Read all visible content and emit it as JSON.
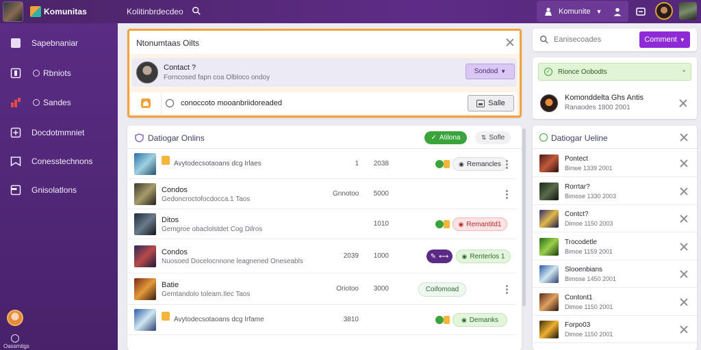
{
  "topbar": {
    "app_name": "Komunitas",
    "breadcrumb": "Kolitinbrdecdeo",
    "community_label": "Komunite"
  },
  "sidebar": {
    "items": [
      {
        "label": "Sapebnaniar",
        "icon": "page-icon"
      },
      {
        "label": "Rbniots",
        "icon": "bookmark-icon"
      },
      {
        "label": "Sandes",
        "icon": "chart-icon"
      },
      {
        "label": "Docdotmmniet",
        "icon": "add-document-icon"
      },
      {
        "label": "Conesstechnons",
        "icon": "inbox-icon"
      },
      {
        "label": "Gnisolatlons",
        "icon": "list-icon"
      }
    ],
    "bottom_label": "Oassmtigs"
  },
  "main_top": {
    "title": "Ntonumtaas Oilts",
    "notice": {
      "name": "Contact ?",
      "subtitle": "Forncosed fapn coa Olbloco ondoy",
      "button": "Sondod"
    },
    "input": {
      "value": "conoccoto mooanbriidoreaded",
      "save_label": "Salle"
    }
  },
  "main_list": {
    "title": "Datiogar Onlins",
    "filter_label": "Atilona",
    "sort_label": "Sofle",
    "rows": [
      {
        "name": "",
        "desc": "Avytodecsotaoans dcg Irlaes",
        "c1": "1",
        "c2": "2038",
        "status": "Remancles",
        "status_style": "gray",
        "variant": "locked"
      },
      {
        "name": "Condos",
        "desc": "Gedoncroctofocdocca.1 Taos",
        "c1": "Gnnotoo",
        "c2": "5000",
        "status": "",
        "status_style": "none",
        "variant": "dots"
      },
      {
        "name": "Ditos",
        "desc": "Gemgroe obaclolstdet Cog Dilros",
        "c1": "",
        "c2": "1010",
        "status": "Remantitd1",
        "status_style": "red",
        "variant": "toggle"
      },
      {
        "name": "Condos",
        "desc": "Nuosoed Docelocnnone leagnened Oneseabls",
        "c1": "2039",
        "c2": "1000",
        "status": "Renterlos 1",
        "status_style": "green",
        "variant": "purple"
      },
      {
        "name": "Batie",
        "desc": "Gemtandolo toleam.Ilec Taos",
        "c1": "Oriotoo",
        "c2": "3000",
        "status": "Coifomoad",
        "status_style": "outline",
        "variant": "dots"
      },
      {
        "name": "",
        "desc": "Avytodecsotaoans dcg Irfame",
        "c1": "3810",
        "c2": "",
        "status": "Demanks",
        "status_style": "green",
        "variant": "locked"
      }
    ]
  },
  "right": {
    "search_placeholder": "Eanisecoades",
    "comment_button": "Comment",
    "banner": "Rionce Oobodts",
    "featured": {
      "title": "Komonddelta Ghs Antis",
      "subtitle": "Ranaodes 1800 2001"
    },
    "list_title": "Datiogar Ueline",
    "items": [
      {
        "name": "Pontect",
        "sub": "Binwe 1339 2001"
      },
      {
        "name": "Rorrtar?",
        "sub": "Bimose 1330 2003"
      },
      {
        "name": "Contct?",
        "sub": "Dimoe 1150 2003"
      },
      {
        "name": "Trocodetle",
        "sub": "Bimoe 1159 2001"
      },
      {
        "name": "Slooenbians",
        "sub": "Bimose 1450 2001"
      },
      {
        "name": "Contont1",
        "sub": "Dimoe 1150 2001"
      },
      {
        "name": "Forpo03",
        "sub": "Dimoe 1150 2001"
      }
    ]
  }
}
